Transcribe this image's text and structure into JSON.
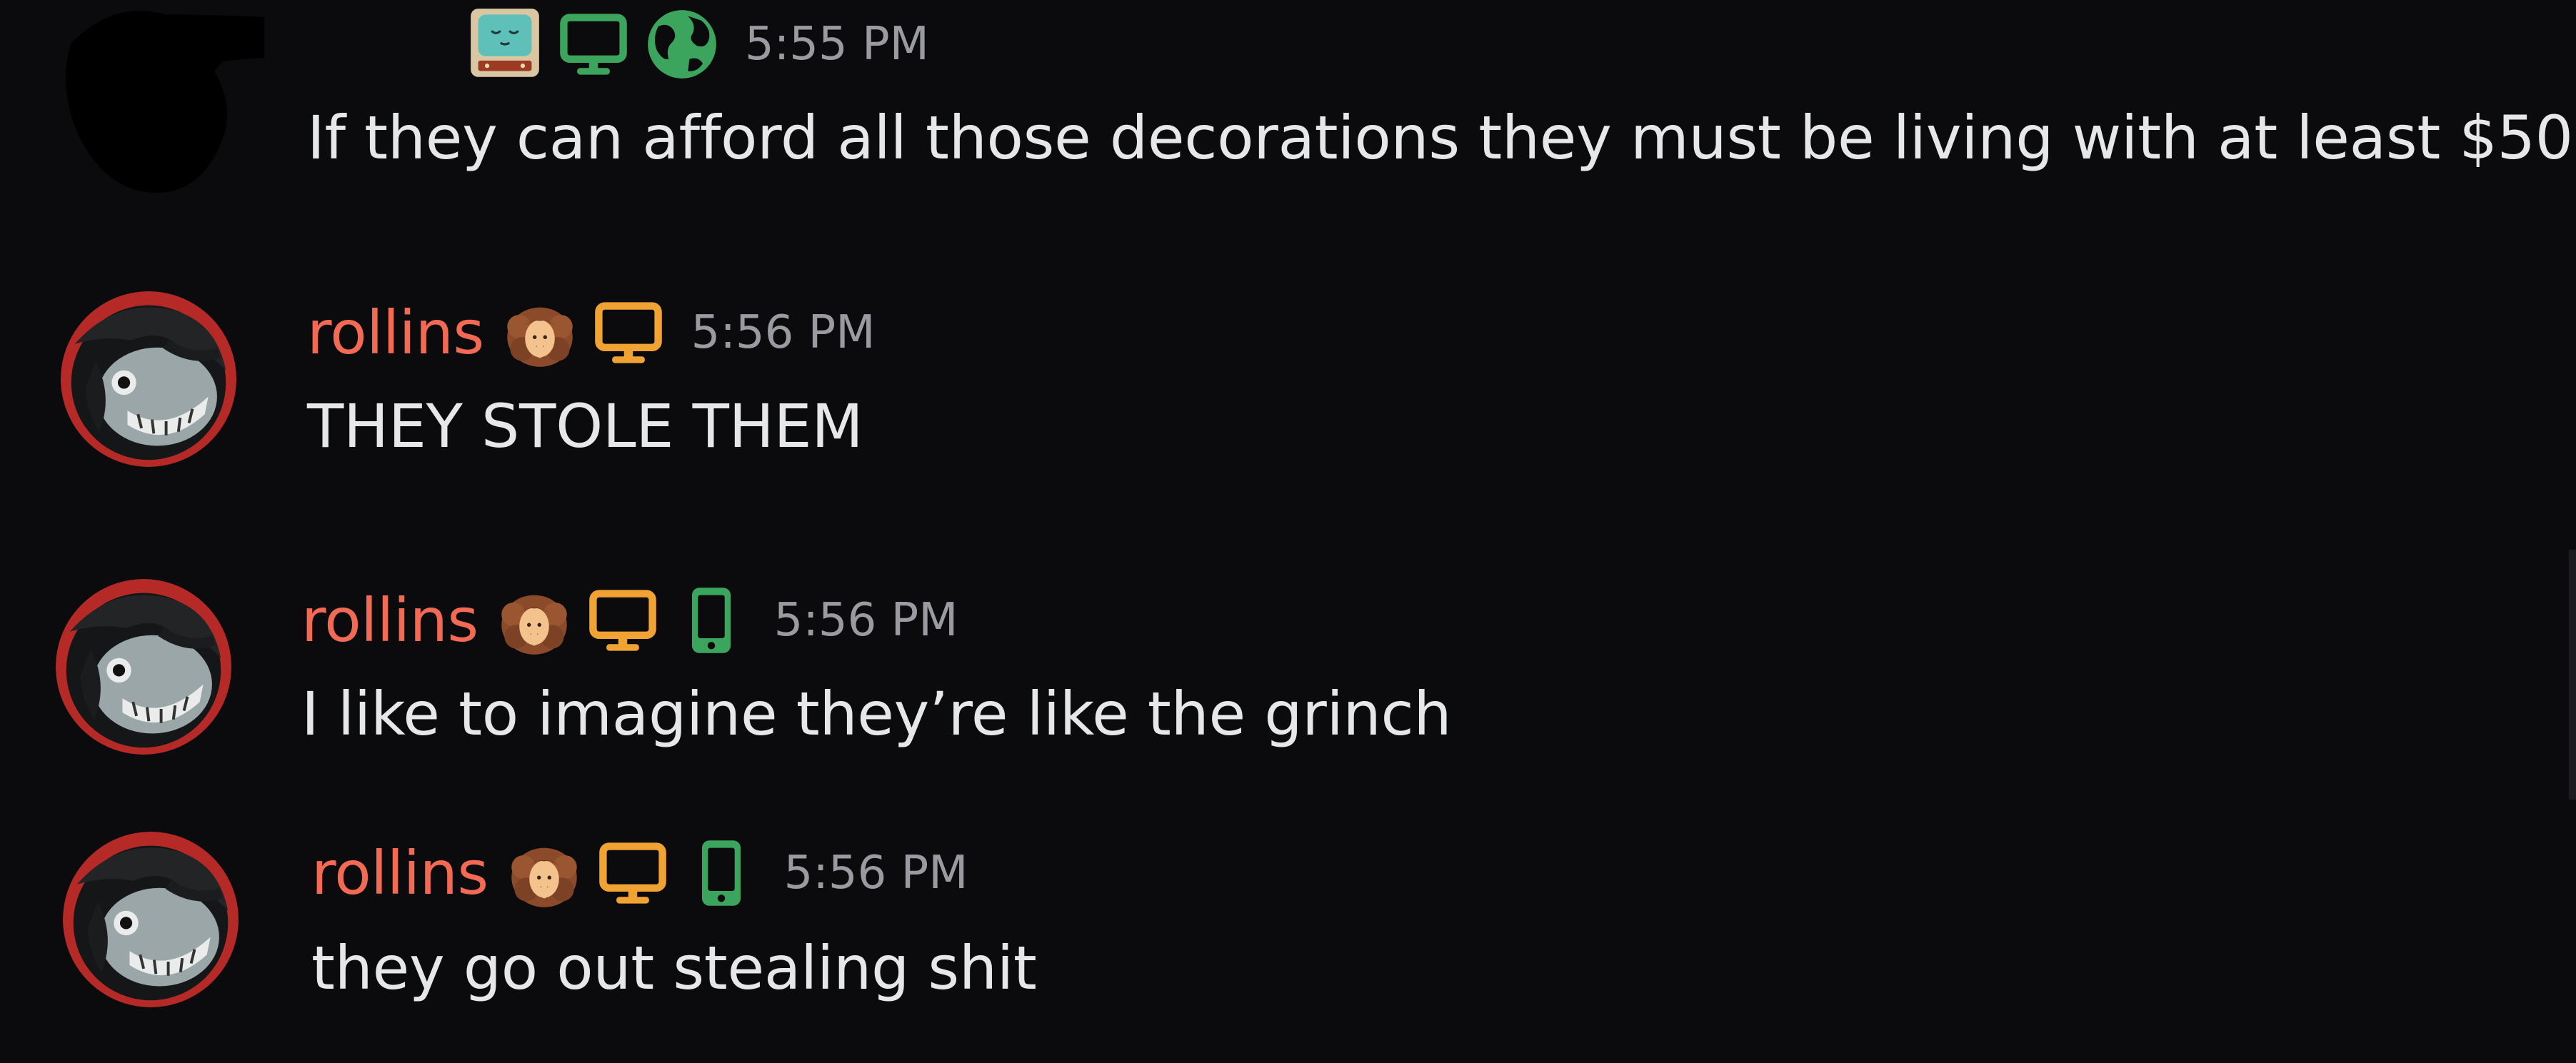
{
  "colors": {
    "background": "#0b0b0d",
    "username": "#f26a54",
    "message_text": "#e6e7e9",
    "timestamp": "#9a9ba1",
    "status_desktop_green": "#3ba55d",
    "status_desktop_orange": "#f0a232",
    "status_mobile_green": "#3ba55d"
  },
  "messages": [
    {
      "author": "",
      "author_redacted": true,
      "badges": [
        "tv-icon",
        "desktop-icon-green",
        "globe-icon-green"
      ],
      "timestamp": "5:55 PM",
      "text": "If they can afford all those decorations they must be living with at least $50"
    },
    {
      "author": "rollins",
      "badges": [
        "woman-emoji-icon",
        "desktop-icon-orange"
      ],
      "timestamp": "5:56 PM",
      "text": "THEY STOLE THEM"
    },
    {
      "author": "rollins",
      "badges": [
        "woman-emoji-icon",
        "desktop-icon-orange",
        "mobile-icon-green"
      ],
      "timestamp": "5:56 PM",
      "text": "I like to imagine they’re like the grinch"
    },
    {
      "author": "rollins",
      "badges": [
        "woman-emoji-icon",
        "desktop-icon-orange",
        "mobile-icon-green"
      ],
      "timestamp": "5:56 PM",
      "text": "they go out stealing shit"
    }
  ]
}
